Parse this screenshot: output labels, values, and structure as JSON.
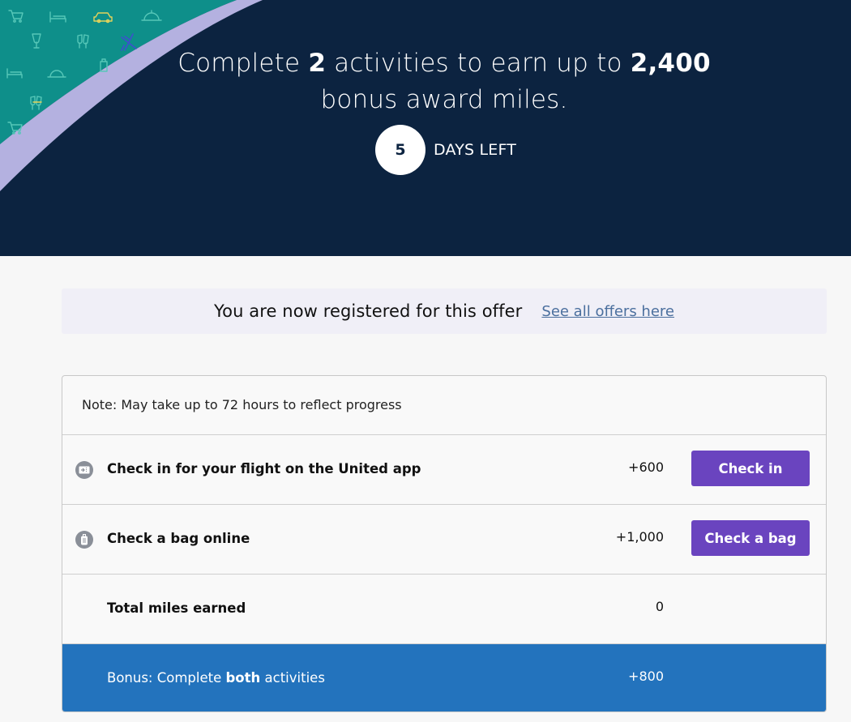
{
  "hero": {
    "headline_part1": "Complete ",
    "activity_count": "2",
    "headline_part2": " activities to earn up to ",
    "miles_amount": "2,400",
    "headline_line2": "bonus award miles.",
    "days_left_number": "5",
    "days_left_label": "DAYS LEFT"
  },
  "banner": {
    "message": "You are now registered for this offer",
    "link_text": "See all offers here"
  },
  "offer": {
    "note": "Note: May take up to 72 hours to reflect progress",
    "activities": [
      {
        "label": "Check in for your flight on the United app",
        "miles": "+600",
        "button": "Check in",
        "icon": "boarding-pass-icon"
      },
      {
        "label": "Check a bag online",
        "miles": "+1,000",
        "button": "Check a bag",
        "icon": "luggage-icon"
      }
    ],
    "total": {
      "label": "Total miles earned",
      "miles": "0"
    },
    "bonus": {
      "label_prefix": "Bonus: Complete ",
      "label_bold": "both",
      "label_suffix": " activities",
      "miles": "+800"
    }
  },
  "colors": {
    "hero_background": "#0c2340",
    "pattern_teal": "#0e8f8a",
    "pattern_wave": "#b4b1e0",
    "button_purple": "#6a44bf",
    "bonus_blue": "#2373bd",
    "link_blue": "#4b6f9e"
  }
}
